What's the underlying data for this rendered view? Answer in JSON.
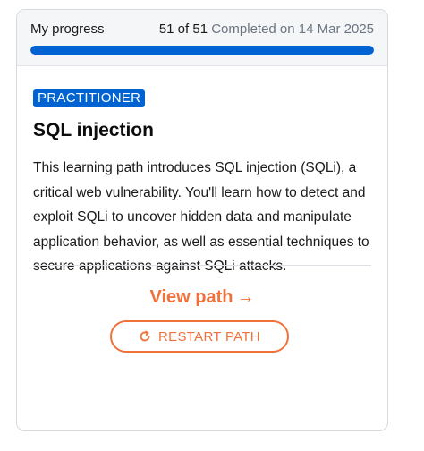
{
  "progress": {
    "label": "My progress",
    "count": "51 of 51",
    "status": "Completed on 14 Mar 2025",
    "fraction": 1.0
  },
  "course": {
    "level": "PRACTITIONER",
    "title": "SQL injection",
    "description": "This learning path introduces SQL injection (SQLi), a critical web vulnerability. You'll learn how to detect and exploit SQLi to uncover hidden data and manipulate application behavior, as well as essential techniques to secure applications against SQLi attacks."
  },
  "actions": {
    "view_label": "View path",
    "view_arrow": "→",
    "view_icon": "arrow-right-icon",
    "restart_label": "RESTART PATH",
    "restart_icon": "restart-icon"
  },
  "colors": {
    "primary_blue": "#0063d1",
    "accent_orange": "#f0713a",
    "muted_text": "#6b7480"
  }
}
